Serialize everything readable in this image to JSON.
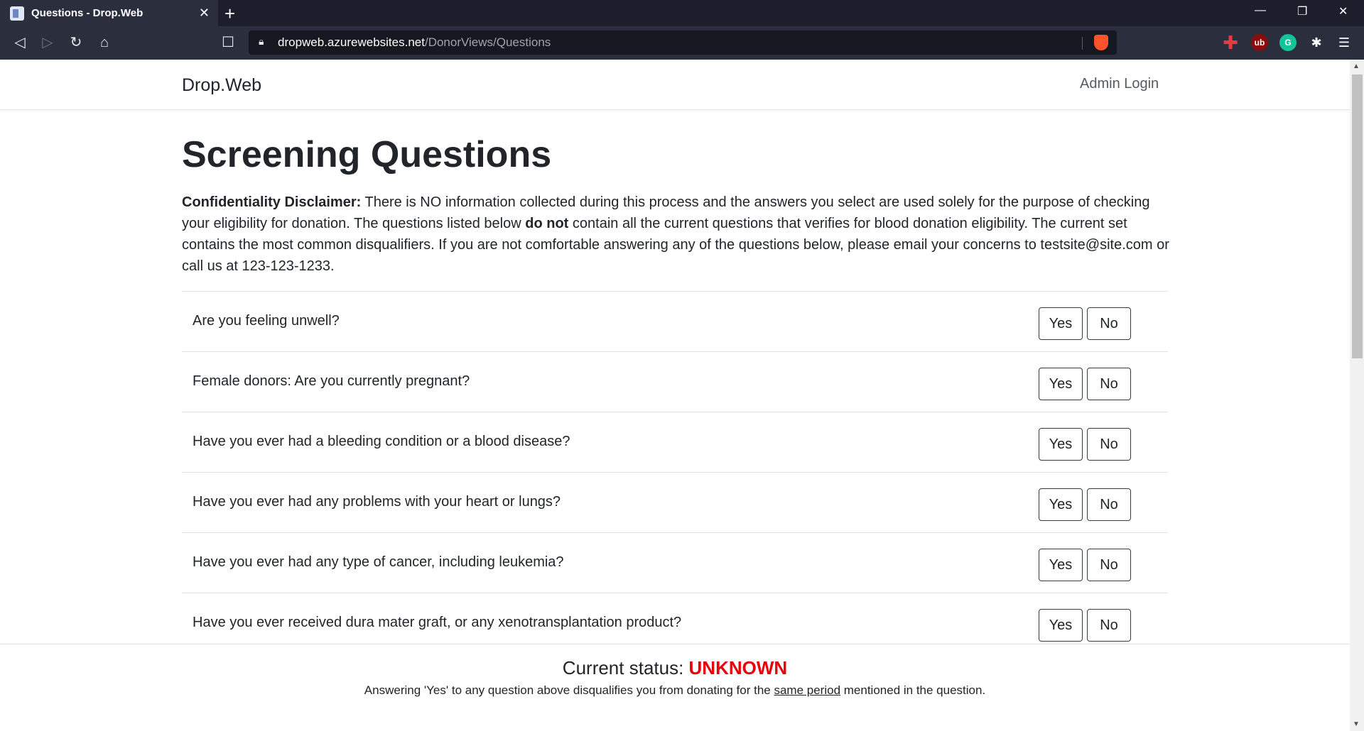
{
  "browser": {
    "tab_title": "Questions - Drop.Web",
    "url_host": "dropweb.azurewebsites.net",
    "url_path": "/DonorViews/Questions"
  },
  "nav": {
    "brand": "Drop.Web",
    "admin_login": "Admin Login"
  },
  "page": {
    "title": "Screening Questions",
    "disclaimer_label": "Confidentiality Disclaimer:",
    "disclaimer_part1": " There is NO information collected during this process and the answers you select are used solely for the purpose of checking your eligibility for donation. The questions listed below ",
    "disclaimer_bold": "do not",
    "disclaimer_part2": " contain all the current questions that verifies for blood donation eligibility. The current set contains the most common disqualifiers. If you are not comfortable answering any of the questions below, please email your concerns to testsite@site.com or call us at 123-123-1233."
  },
  "buttons": {
    "yes": "Yes",
    "no": "No"
  },
  "questions": [
    "Are you feeling unwell?",
    "Female donors: Are you currently pregnant?",
    "Have you ever had a bleeding condition or a blood disease?",
    "Have you ever had any problems with your heart or lungs?",
    "Have you ever had any type of cancer, including leukemia?",
    "Have you ever received dura mater graft, or any xenotransplantation product?"
  ],
  "status": {
    "label": "Current status: ",
    "value": "UNKNOWN",
    "note_part1": "Answering 'Yes' to any question above disqualifies you from donating for the ",
    "note_underline": "same period",
    "note_part2": " mentioned in the question."
  }
}
